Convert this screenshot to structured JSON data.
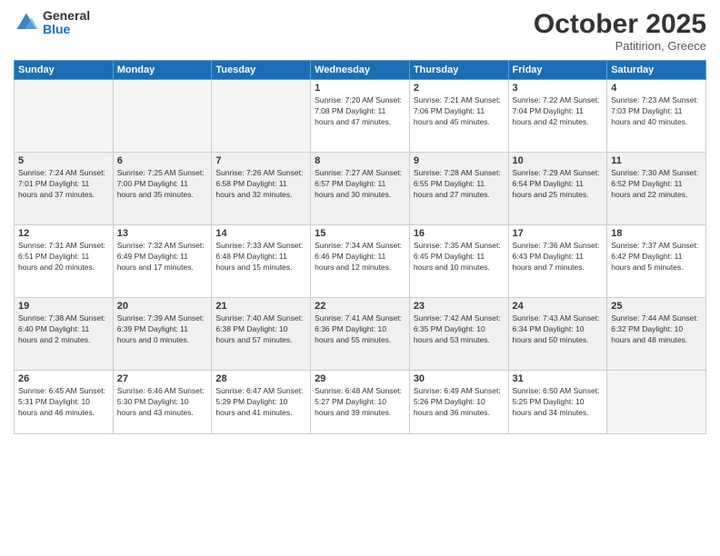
{
  "logo": {
    "general": "General",
    "blue": "Blue"
  },
  "header": {
    "month": "October 2025",
    "location": "Patitirion, Greece"
  },
  "days_of_week": [
    "Sunday",
    "Monday",
    "Tuesday",
    "Wednesday",
    "Thursday",
    "Friday",
    "Saturday"
  ],
  "weeks": [
    [
      {
        "day": "",
        "info": ""
      },
      {
        "day": "",
        "info": ""
      },
      {
        "day": "",
        "info": ""
      },
      {
        "day": "1",
        "info": "Sunrise: 7:20 AM\nSunset: 7:08 PM\nDaylight: 11 hours\nand 47 minutes."
      },
      {
        "day": "2",
        "info": "Sunrise: 7:21 AM\nSunset: 7:06 PM\nDaylight: 11 hours\nand 45 minutes."
      },
      {
        "day": "3",
        "info": "Sunrise: 7:22 AM\nSunset: 7:04 PM\nDaylight: 11 hours\nand 42 minutes."
      },
      {
        "day": "4",
        "info": "Sunrise: 7:23 AM\nSunset: 7:03 PM\nDaylight: 11 hours\nand 40 minutes."
      }
    ],
    [
      {
        "day": "5",
        "info": "Sunrise: 7:24 AM\nSunset: 7:01 PM\nDaylight: 11 hours\nand 37 minutes."
      },
      {
        "day": "6",
        "info": "Sunrise: 7:25 AM\nSunset: 7:00 PM\nDaylight: 11 hours\nand 35 minutes."
      },
      {
        "day": "7",
        "info": "Sunrise: 7:26 AM\nSunset: 6:58 PM\nDaylight: 11 hours\nand 32 minutes."
      },
      {
        "day": "8",
        "info": "Sunrise: 7:27 AM\nSunset: 6:57 PM\nDaylight: 11 hours\nand 30 minutes."
      },
      {
        "day": "9",
        "info": "Sunrise: 7:28 AM\nSunset: 6:55 PM\nDaylight: 11 hours\nand 27 minutes."
      },
      {
        "day": "10",
        "info": "Sunrise: 7:29 AM\nSunset: 6:54 PM\nDaylight: 11 hours\nand 25 minutes."
      },
      {
        "day": "11",
        "info": "Sunrise: 7:30 AM\nSunset: 6:52 PM\nDaylight: 11 hours\nand 22 minutes."
      }
    ],
    [
      {
        "day": "12",
        "info": "Sunrise: 7:31 AM\nSunset: 6:51 PM\nDaylight: 11 hours\nand 20 minutes."
      },
      {
        "day": "13",
        "info": "Sunrise: 7:32 AM\nSunset: 6:49 PM\nDaylight: 11 hours\nand 17 minutes."
      },
      {
        "day": "14",
        "info": "Sunrise: 7:33 AM\nSunset: 6:48 PM\nDaylight: 11 hours\nand 15 minutes."
      },
      {
        "day": "15",
        "info": "Sunrise: 7:34 AM\nSunset: 6:46 PM\nDaylight: 11 hours\nand 12 minutes."
      },
      {
        "day": "16",
        "info": "Sunrise: 7:35 AM\nSunset: 6:45 PM\nDaylight: 11 hours\nand 10 minutes."
      },
      {
        "day": "17",
        "info": "Sunrise: 7:36 AM\nSunset: 6:43 PM\nDaylight: 11 hours\nand 7 minutes."
      },
      {
        "day": "18",
        "info": "Sunrise: 7:37 AM\nSunset: 6:42 PM\nDaylight: 11 hours\nand 5 minutes."
      }
    ],
    [
      {
        "day": "19",
        "info": "Sunrise: 7:38 AM\nSunset: 6:40 PM\nDaylight: 11 hours\nand 2 minutes."
      },
      {
        "day": "20",
        "info": "Sunrise: 7:39 AM\nSunset: 6:39 PM\nDaylight: 11 hours\nand 0 minutes."
      },
      {
        "day": "21",
        "info": "Sunrise: 7:40 AM\nSunset: 6:38 PM\nDaylight: 10 hours\nand 57 minutes."
      },
      {
        "day": "22",
        "info": "Sunrise: 7:41 AM\nSunset: 6:36 PM\nDaylight: 10 hours\nand 55 minutes."
      },
      {
        "day": "23",
        "info": "Sunrise: 7:42 AM\nSunset: 6:35 PM\nDaylight: 10 hours\nand 53 minutes."
      },
      {
        "day": "24",
        "info": "Sunrise: 7:43 AM\nSunset: 6:34 PM\nDaylight: 10 hours\nand 50 minutes."
      },
      {
        "day": "25",
        "info": "Sunrise: 7:44 AM\nSunset: 6:32 PM\nDaylight: 10 hours\nand 48 minutes."
      }
    ],
    [
      {
        "day": "26",
        "info": "Sunrise: 6:45 AM\nSunset: 5:31 PM\nDaylight: 10 hours\nand 46 minutes."
      },
      {
        "day": "27",
        "info": "Sunrise: 6:46 AM\nSunset: 5:30 PM\nDaylight: 10 hours\nand 43 minutes."
      },
      {
        "day": "28",
        "info": "Sunrise: 6:47 AM\nSunset: 5:29 PM\nDaylight: 10 hours\nand 41 minutes."
      },
      {
        "day": "29",
        "info": "Sunrise: 6:48 AM\nSunset: 5:27 PM\nDaylight: 10 hours\nand 39 minutes."
      },
      {
        "day": "30",
        "info": "Sunrise: 6:49 AM\nSunset: 5:26 PM\nDaylight: 10 hours\nand 36 minutes."
      },
      {
        "day": "31",
        "info": "Sunrise: 6:50 AM\nSunset: 5:25 PM\nDaylight: 10 hours\nand 34 minutes."
      },
      {
        "day": "",
        "info": ""
      }
    ]
  ]
}
